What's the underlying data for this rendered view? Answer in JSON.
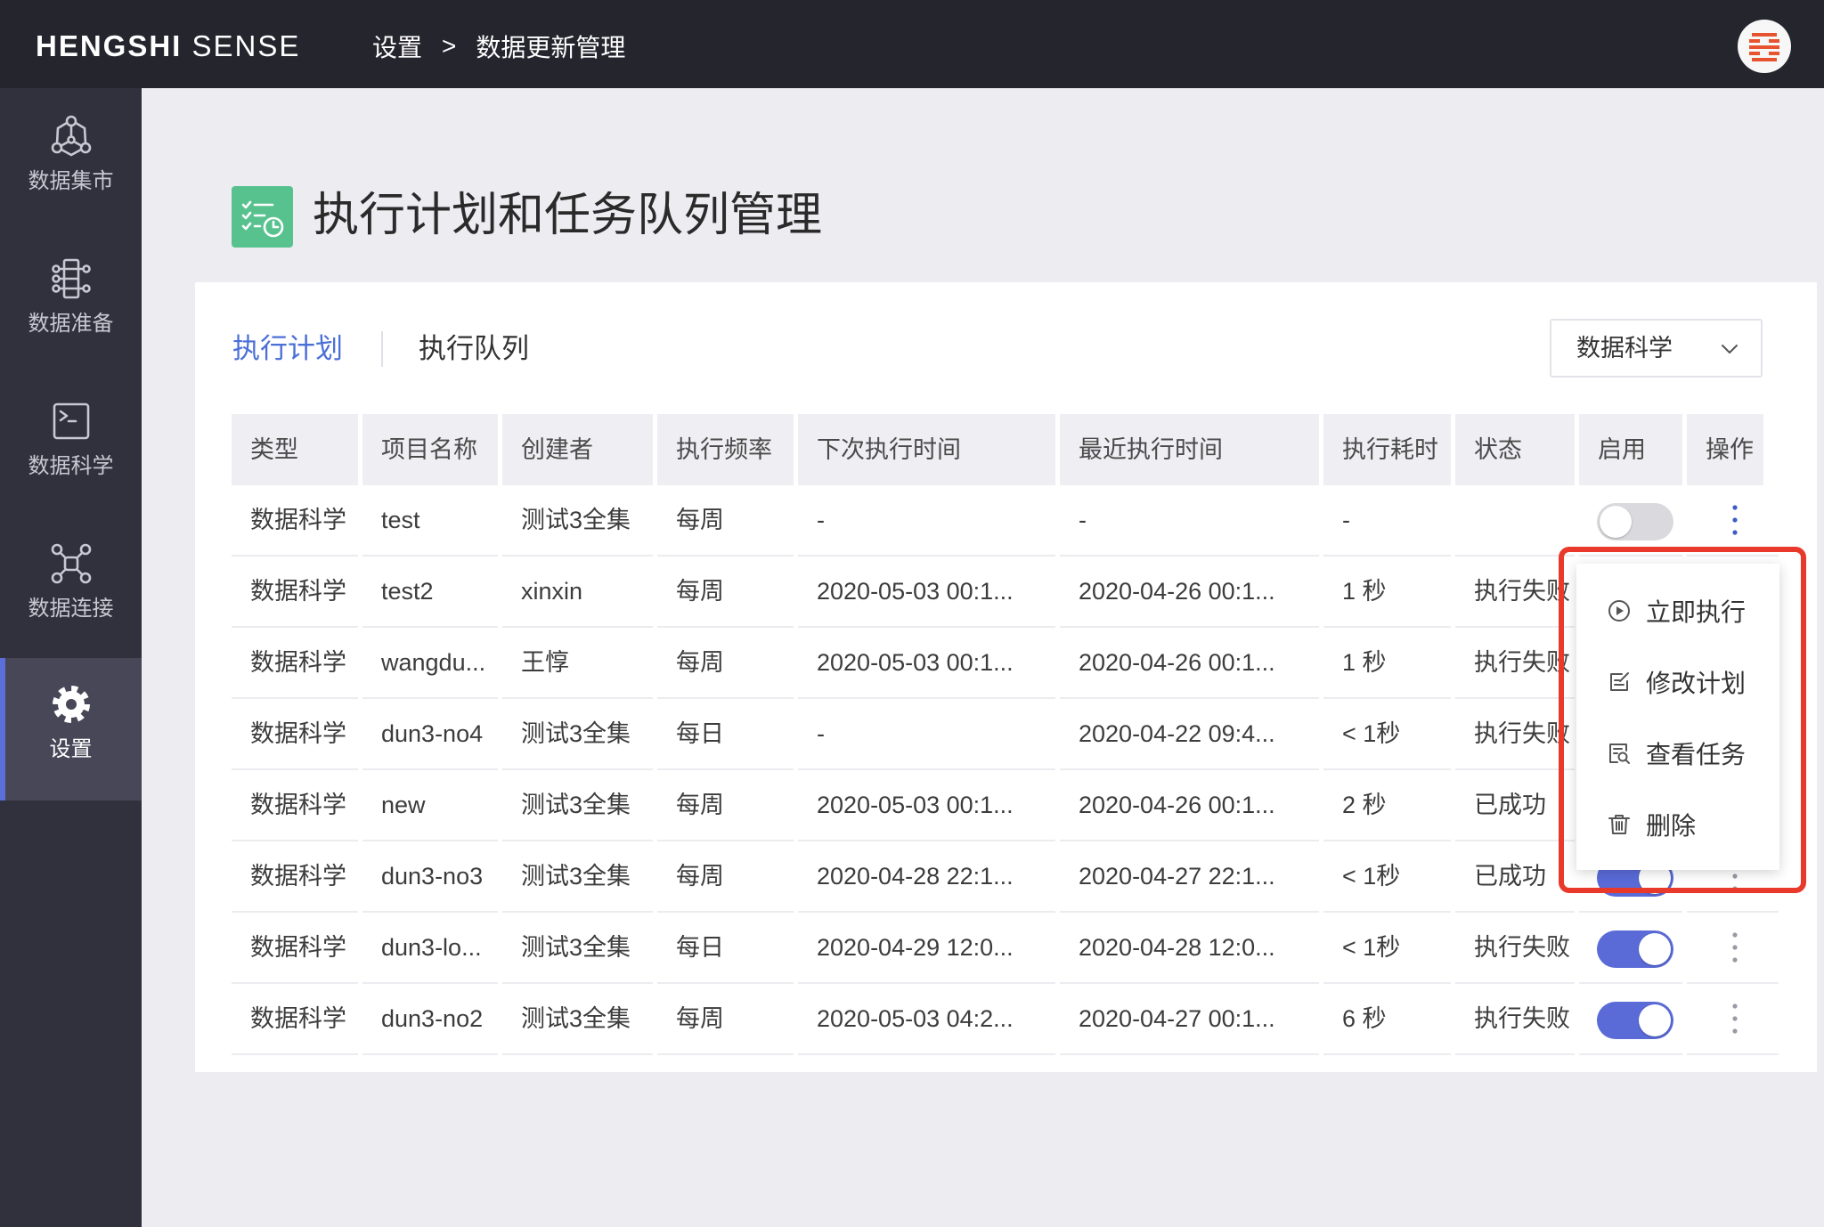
{
  "topbar": {
    "logo_primary": "HENGSHI",
    "logo_secondary": "SENSE",
    "breadcrumb": [
      "设置",
      ">",
      "数据更新管理"
    ],
    "avatar_icon": "hengshi-logo-icon"
  },
  "sidebar": {
    "items": [
      {
        "label": "数据集市",
        "icon": "data-mart-icon",
        "selected": false
      },
      {
        "label": "数据准备",
        "icon": "data-prep-icon",
        "selected": false
      },
      {
        "label": "数据科学",
        "icon": "terminal-icon",
        "selected": false
      },
      {
        "label": "数据连接",
        "icon": "connection-icon",
        "selected": false
      },
      {
        "label": "设置",
        "icon": "gear-icon",
        "selected": true
      }
    ]
  },
  "page": {
    "title": "执行计划和任务队列管理",
    "title_icon": "schedule-checklist-icon"
  },
  "tabs": [
    {
      "label": "执行计划",
      "active": true
    },
    {
      "label": "执行队列",
      "active": false
    }
  ],
  "filter": {
    "selected": "数据科学",
    "icon": "chevron-down-icon"
  },
  "table": {
    "columns": [
      "类型",
      "项目名称",
      "创建者",
      "执行频率",
      "下次执行时间",
      "最近执行时间",
      "执行耗时",
      "状态",
      "启用",
      "操作"
    ],
    "rows": [
      {
        "type": "数据科学",
        "project": "test",
        "creator": "测试3全集",
        "frequency": "每周",
        "next_run": "-",
        "last_run": "-",
        "duration": "-",
        "status": "",
        "enabled": false,
        "actions_active": true
      },
      {
        "type": "数据科学",
        "project": "test2",
        "creator": "xinxin",
        "frequency": "每周",
        "next_run": "2020-05-03 00:1...",
        "last_run": "2020-04-26 00:1...",
        "duration": "1 秒",
        "status": "执行失败",
        "enabled": null,
        "actions_active": false
      },
      {
        "type": "数据科学",
        "project": "wangdu...",
        "creator": "王惇",
        "frequency": "每周",
        "next_run": "2020-05-03 00:1...",
        "last_run": "2020-04-26 00:1...",
        "duration": "1 秒",
        "status": "执行失败",
        "enabled": null,
        "actions_active": false
      },
      {
        "type": "数据科学",
        "project": "dun3-no4",
        "creator": "测试3全集",
        "frequency": "每日",
        "next_run": "-",
        "last_run": "2020-04-22 09:4...",
        "duration": "< 1秒",
        "status": "执行失败",
        "enabled": null,
        "actions_active": false
      },
      {
        "type": "数据科学",
        "project": "new",
        "creator": "测试3全集",
        "frequency": "每周",
        "next_run": "2020-05-03 00:1...",
        "last_run": "2020-04-26 00:1...",
        "duration": "2 秒",
        "status": "已成功",
        "enabled": null,
        "actions_active": false
      },
      {
        "type": "数据科学",
        "project": "dun3-no3",
        "creator": "测试3全集",
        "frequency": "每周",
        "next_run": "2020-04-28 22:1...",
        "last_run": "2020-04-27 22:1...",
        "duration": "< 1秒",
        "status": "已成功",
        "enabled": true,
        "actions_active": false
      },
      {
        "type": "数据科学",
        "project": "dun3-lo...",
        "creator": "测试3全集",
        "frequency": "每日",
        "next_run": "2020-04-29 12:0...",
        "last_run": "2020-04-28 12:0...",
        "duration": "< 1秒",
        "status": "执行失败",
        "enabled": true,
        "actions_active": false
      },
      {
        "type": "数据科学",
        "project": "dun3-no2",
        "creator": "测试3全集",
        "frequency": "每周",
        "next_run": "2020-05-03 04:2...",
        "last_run": "2020-04-27 00:1...",
        "duration": "6 秒",
        "status": "执行失败",
        "enabled": true,
        "actions_active": false
      }
    ]
  },
  "row_menu": {
    "items": [
      {
        "label": "立即执行",
        "icon": "play-circle-icon"
      },
      {
        "label": "修改计划",
        "icon": "edit-icon"
      },
      {
        "label": "查看任务",
        "icon": "view-task-icon"
      },
      {
        "label": "删除",
        "icon": "trash-icon"
      }
    ]
  },
  "colors": {
    "topbar": "#25252e",
    "sidebar": "#31313d",
    "accent_blue": "#4b6fd7",
    "toggle_on": "#5a6bd8",
    "title_icon_green": "#58c28f",
    "highlight_red": "#e9392a",
    "brand_orange": "#e8532f"
  }
}
